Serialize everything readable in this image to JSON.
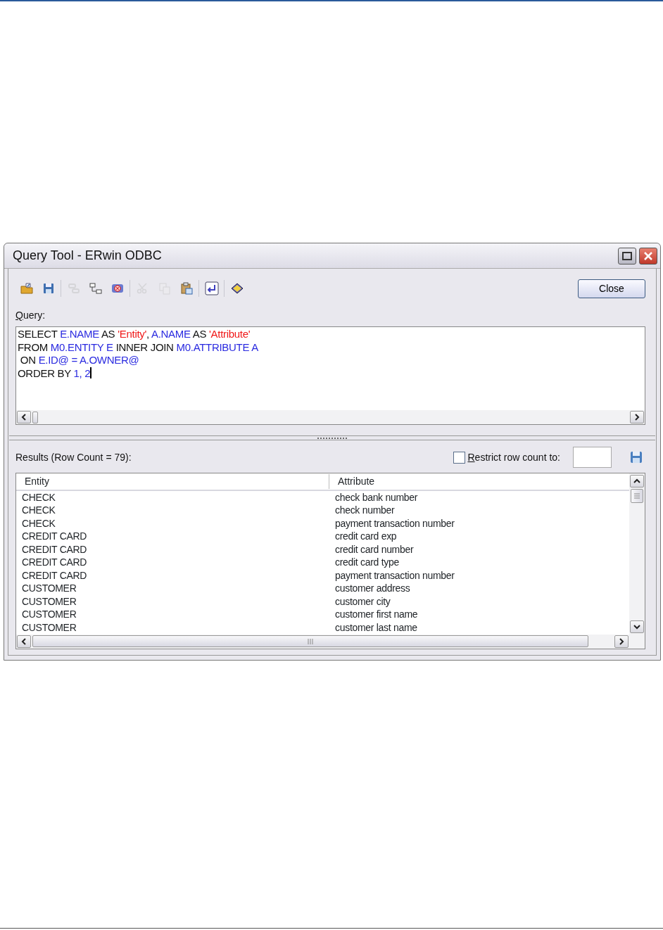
{
  "window": {
    "title": "Query Tool - ERwin ODBC"
  },
  "toolbar": [
    {
      "kind": "open",
      "disabled": false
    },
    {
      "kind": "save",
      "disabled": false
    },
    {
      "kind": "separator"
    },
    {
      "kind": "link",
      "disabled": true
    },
    {
      "kind": "relation",
      "disabled": false
    },
    {
      "kind": "unlink",
      "disabled": false
    },
    {
      "kind": "separator"
    },
    {
      "kind": "cut",
      "disabled": true
    },
    {
      "kind": "copy",
      "disabled": true
    },
    {
      "kind": "paste",
      "disabled": false
    },
    {
      "kind": "separator"
    },
    {
      "kind": "execute",
      "disabled": false
    },
    {
      "kind": "separator"
    },
    {
      "kind": "help",
      "disabled": false
    }
  ],
  "close_button": "Close",
  "query": {
    "label": "Query:",
    "lines": [
      [
        {
          "kind": "keyword",
          "text": "SELECT "
        },
        {
          "kind": "identifier",
          "text": "E.NAME"
        },
        {
          "kind": "keyword",
          "text": " AS "
        },
        {
          "kind": "string",
          "text": "'Entity'"
        },
        {
          "kind": "keyword",
          "text": ", "
        },
        {
          "kind": "identifier",
          "text": "A.NAME"
        },
        {
          "kind": "keyword",
          "text": " AS "
        },
        {
          "kind": "string",
          "text": "'Attribute'"
        }
      ],
      [
        {
          "kind": "keyword",
          "text": "FROM "
        },
        {
          "kind": "identifier",
          "text": "M0.ENTITY E"
        },
        {
          "kind": "keyword",
          "text": " INNER JOIN "
        },
        {
          "kind": "identifier",
          "text": "M0.ATTRIBUTE A"
        }
      ],
      [
        {
          "kind": "keyword",
          "text": " ON "
        },
        {
          "kind": "identifier",
          "text": "E.ID@ = A.OWNER@"
        }
      ],
      [
        {
          "kind": "keyword",
          "text": "ORDER BY "
        },
        {
          "kind": "identifier",
          "text": "1, 2"
        }
      ]
    ]
  },
  "results": {
    "label": "Results (Row Count = 79):",
    "restrict": {
      "label": "Restrict row count to:",
      "checked": false
    },
    "columns": [
      "Entity",
      "Attribute"
    ],
    "rows": [
      [
        "CHECK",
        "check bank number"
      ],
      [
        "CHECK",
        "check number"
      ],
      [
        "CHECK",
        "payment transaction number"
      ],
      [
        "CREDIT CARD",
        "credit card exp"
      ],
      [
        "CREDIT CARD",
        "credit card number"
      ],
      [
        "CREDIT CARD",
        "credit card type"
      ],
      [
        "CREDIT CARD",
        "payment transaction number"
      ],
      [
        "CUSTOMER",
        "customer address"
      ],
      [
        "CUSTOMER",
        "customer city"
      ],
      [
        "CUSTOMER",
        "customer first name"
      ],
      [
        "CUSTOMER",
        "customer last name"
      ]
    ]
  }
}
